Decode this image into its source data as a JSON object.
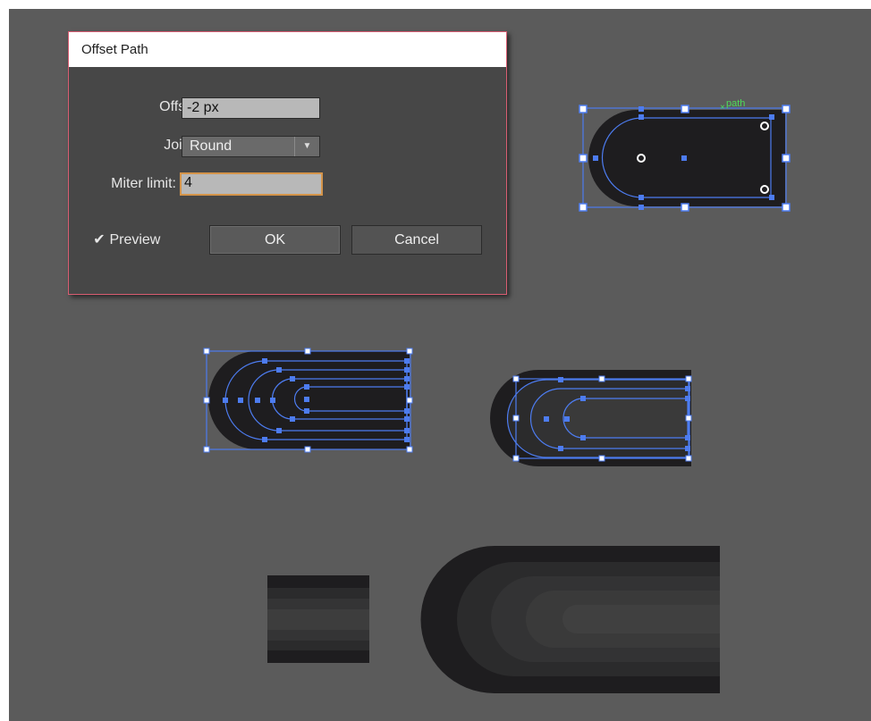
{
  "dialog": {
    "title": "Offset Path",
    "offset_label": "Offset:",
    "offset_value": "-2 px",
    "joins_label": "Joins:",
    "joins_value": "Round",
    "miter_label": "Miter limit:",
    "miter_value": "4",
    "preview_label": "Preview",
    "preview_checked": true,
    "ok_label": "OK",
    "cancel_label": "Cancel"
  },
  "canvas": {
    "path_hint": "path",
    "background": "#5b5b5b",
    "shape_fill": "#1e1d1f",
    "selection_color": "#4d7cf0",
    "hint_color": "#4ddb5a"
  }
}
